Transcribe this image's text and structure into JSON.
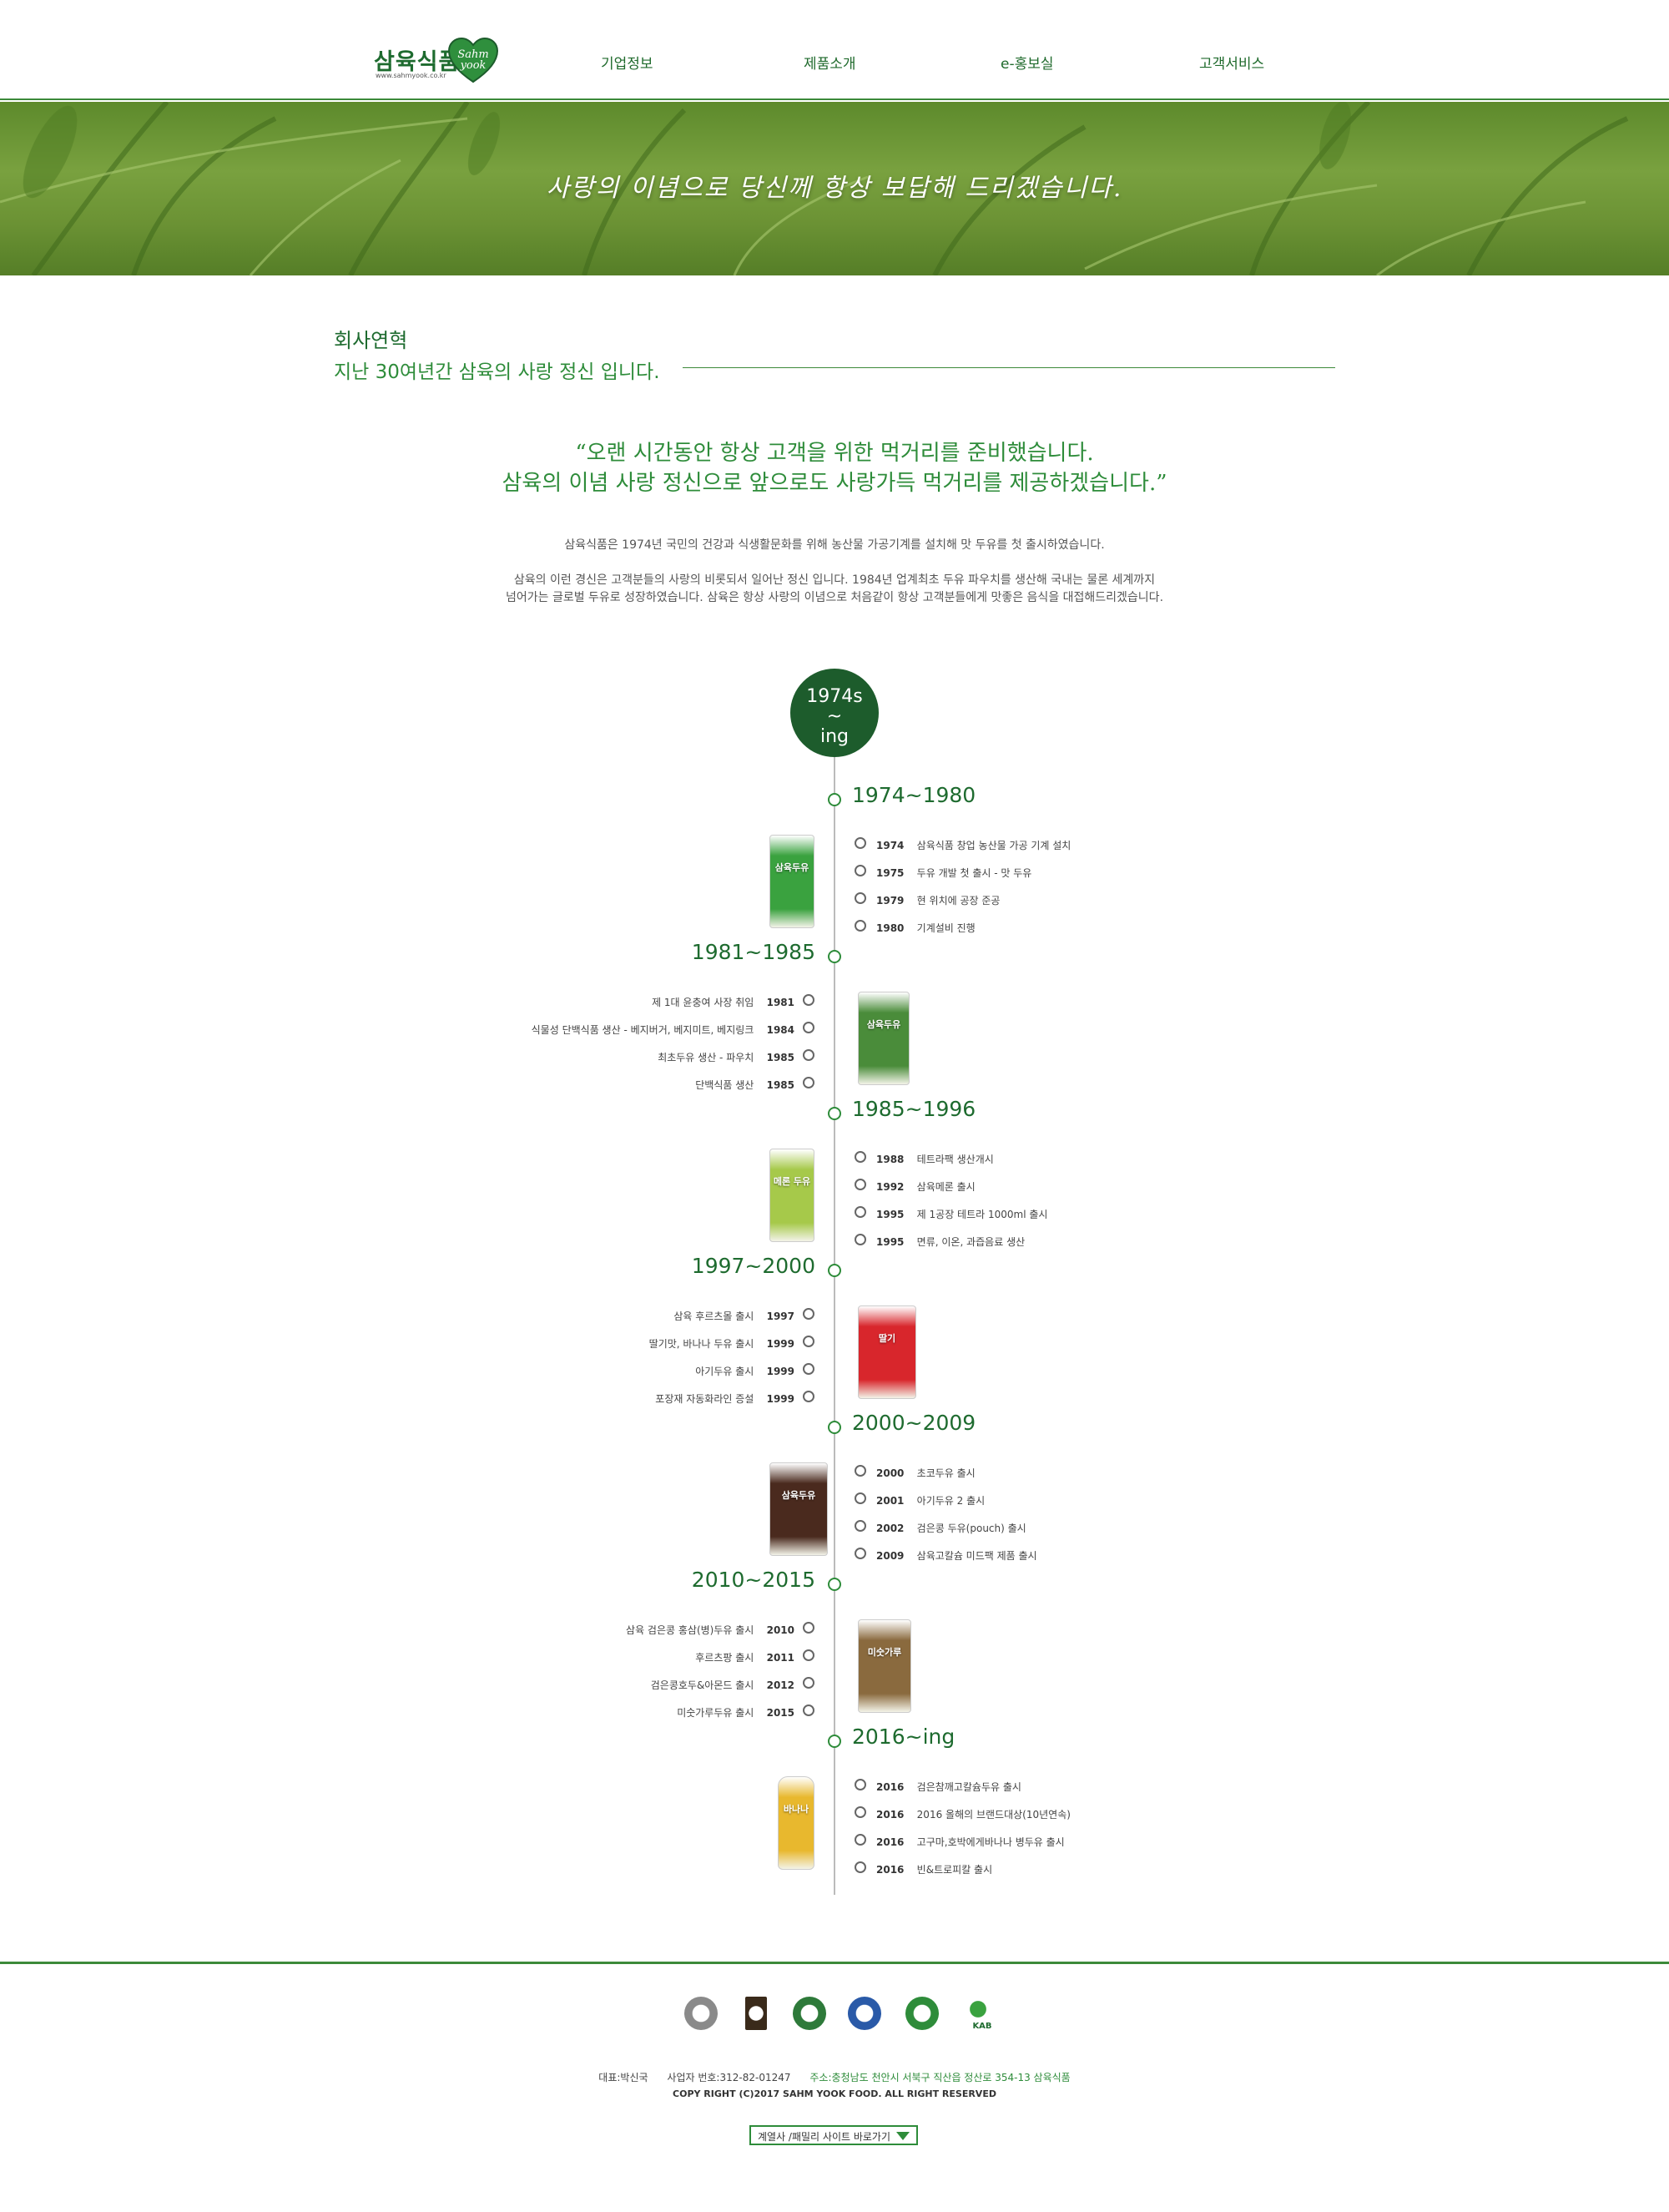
{
  "header": {
    "logo_text": "삼육식품",
    "logo_badge": "Sahm yook",
    "logo_url": "www.sahmyook.co.kr",
    "nav": [
      "기업정보",
      "제품소개",
      "e-홍보실",
      "고객서비스"
    ]
  },
  "banner": {
    "text": "사랑의 이념으로 당신께 항상 보답해 드리겠습니다."
  },
  "section": {
    "title": "회사연혁",
    "subtitle": "지난 30여년간 삼육의 사랑 정신 입니다."
  },
  "quote": {
    "line1": "“오랜 시간동안 항상 고객을 위한 먹거리를 준비했습니다.",
    "line2": "삼육의 이념 사랑 정신으로 앞으로도 사랑가득 먹거리를 제공하겠습니다.”"
  },
  "intro": {
    "p1": "삼육식품은 1974년 국민의 건강과 식생활문화를 위해 농산물 가공기계를 설치해  맛 두유를 첫 출시하였습니다.",
    "p2a": "삼육의 이런 경신은 고객분들의 사랑의 비롯되서 일어난 정신 입니다. 1984년 업계최초 두유 파우치를 생산해 국내는 물론 세계까지",
    "p2b": "넘어가는 글로벌 두유로 성장하였습니다. 삼육은 항상 사랑의 이념으로 처음같이 항상 고객분들에게 맛좋은 음식을 대접해드리겠습니다."
  },
  "timeline": {
    "badge_line1": "1974s",
    "badge_line2": "~",
    "badge_line3": "ing",
    "periods": [
      {
        "label": "1974~1980",
        "items": [
          {
            "year": "1974",
            "text": "삼육식품 창업 농산물 가공 기계 설치"
          },
          {
            "year": "1975",
            "text": "두유 개발 첫 출시 - 맛 두유"
          },
          {
            "year": "1979",
            "text": "현 위치에 공장 준공"
          },
          {
            "year": "1980",
            "text": "기계설비 진행"
          }
        ]
      },
      {
        "label": "1981~1985",
        "items": [
          {
            "year": "1981",
            "text": "제 1대 윤충여 사장 취임"
          },
          {
            "year": "1984",
            "text": "식물성 단백식품 생산 - 베지버거, 베지미트, 베지링크"
          },
          {
            "year": "1985",
            "text": "최초두유 생산 - 파우치"
          },
          {
            "year": "1985",
            "text": "단백식품 생산"
          }
        ]
      },
      {
        "label": "1985~1996",
        "items": [
          {
            "year": "1988",
            "text": "테트라팩 생산개시"
          },
          {
            "year": "1992",
            "text": "삼육메론 출시"
          },
          {
            "year": "1995",
            "text": "제 1공장 테트라 1000ml 출시"
          },
          {
            "year": "1995",
            "text": "면류, 이온, 과즙음료 생산"
          }
        ]
      },
      {
        "label": "1997~2000",
        "items": [
          {
            "year": "1997",
            "text": "삼육 후르츠몰 출시"
          },
          {
            "year": "1999",
            "text": "딸기맛, 바나나 두유 출시"
          },
          {
            "year": "1999",
            "text": "아기두유 출시"
          },
          {
            "year": "1999",
            "text": "포장재 자동화라인 증설"
          }
        ]
      },
      {
        "label": "2000~2009",
        "items": [
          {
            "year": "2000",
            "text": "초코두유 출시"
          },
          {
            "year": "2001",
            "text": "아기두유 2 출시"
          },
          {
            "year": "2002",
            "text": "검은콩 두유(pouch) 출시"
          },
          {
            "year": "2009",
            "text": "삼육고칼슘 미드팩 제품 출시"
          }
        ]
      },
      {
        "label": "2010~2015",
        "items": [
          {
            "year": "2010",
            "text": "삼육 검은콩 홍삼(병)두유 출시"
          },
          {
            "year": "2011",
            "text": "후르츠팡 출시"
          },
          {
            "year": "2012",
            "text": "검은콩호두&아몬드 출시"
          },
          {
            "year": "2015",
            "text": "미숫가루두유 출시"
          }
        ]
      },
      {
        "label": "2016~ing",
        "items": [
          {
            "year": "2016",
            "text": "검은참깨고칼슘두유 출시"
          },
          {
            "year": "2016",
            "text": "2016 올해의 브랜드대상(10년연속)"
          },
          {
            "year": "2016",
            "text": "고구마,호박에게바나나 병두유 출시"
          },
          {
            "year": "2016",
            "text": "빈&트로피칼 출시"
          }
        ]
      }
    ],
    "products": [
      {
        "label": "삼육두유",
        "color": "#3aa23f"
      },
      {
        "label": "삼육두유",
        "color": "#4a8c3a"
      },
      {
        "label": "메론 두유",
        "color": "#a6c94a"
      },
      {
        "label": "딸기",
        "color": "#d8262c"
      },
      {
        "label": "삼육두유",
        "color": "#4a2a1e"
      },
      {
        "label": "미숫가루",
        "color": "#8a6a3e"
      },
      {
        "label": "바나나",
        "color": "#e8b82e"
      }
    ]
  },
  "footer": {
    "certs": [
      "cert-seal",
      "award",
      "haccp-gmp",
      "kfq",
      "haccp",
      "kab"
    ],
    "cert_kab": "KAB",
    "ceo": "대표:박신국",
    "bizno": "사업자 번호:312-82-01247",
    "addr": "주소:충청남도 천안시 서북구 직산읍 정산로 354-13 삼육식품",
    "copyright": "COPY RIGHT (C)2017 SAHM YOOK FOOD. ALL RIGHT RESERVED",
    "family_site": "계열사 /패밀리 사이트 바로가기"
  }
}
